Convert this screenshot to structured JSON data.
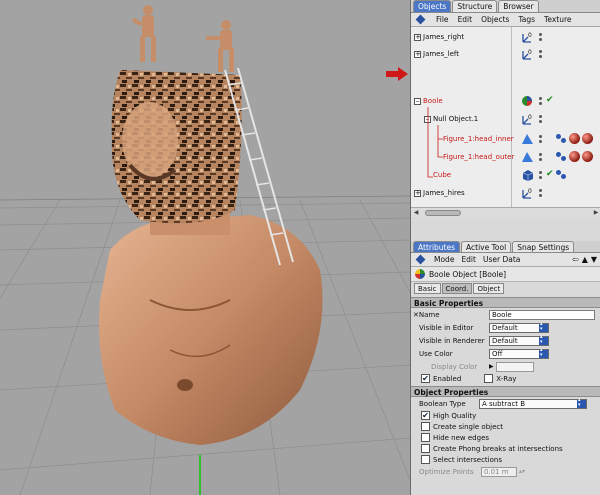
{
  "objects_panel": {
    "tabs": [
      "Objects",
      "Structure",
      "Browser"
    ],
    "menu": [
      "File",
      "Edit",
      "Objects",
      "Tags",
      "Texture"
    ],
    "rows": [
      {
        "name": "James_right"
      },
      {
        "name": "James_left"
      },
      {
        "name": "Boole"
      },
      {
        "name": "Null Object.1"
      },
      {
        "name": "Figure_1:head_inner"
      },
      {
        "name": "Figure_1:head_outer"
      },
      {
        "name": "Cube"
      },
      {
        "name": "James_hires"
      }
    ],
    "null_icon_digit": "0"
  },
  "attributes_panel": {
    "tabs": [
      "Attributes",
      "Active Tool",
      "Snap Settings"
    ],
    "menu": [
      "Mode",
      "Edit",
      "User Data"
    ],
    "nav_arrows": [
      "⇦",
      "▲",
      "▼"
    ],
    "object_title": "Boole Object [Boole]",
    "subtabs": [
      "Basic",
      "Coord.",
      "Object"
    ],
    "basic_section": {
      "title": "Basic Properties",
      "name_label": "Name",
      "name_prefix": "✕",
      "name_value": "Boole",
      "visible_editor_label": "Visible in Editor",
      "visible_editor_value": "Default",
      "visible_renderer_label": "Visible in Renderer",
      "visible_renderer_value": "Default",
      "use_color_label": "Use Color",
      "use_color_value": "Off",
      "display_color_label": "Display Color",
      "enabled_label": "Enabled",
      "xray_label": "X-Ray"
    },
    "object_section": {
      "title": "Object Properties",
      "boolean_type_label": "Boolean Type",
      "boolean_type_value": "A subtract B",
      "high_quality_label": "High Quality",
      "create_single_label": "Create single object",
      "hide_edges_label": "Hide new edges",
      "phong_breaks_label": "Create Phong breaks at intersections",
      "select_intersections_label": "Select intersections",
      "optimize_points_label": "Optimize Points",
      "optimize_points_value": "0.01 m"
    }
  },
  "colors": {
    "tab_active": "#4c76c6",
    "selected_label": "#c81919",
    "arrow_marker": "#d01818",
    "check": "#1f8a1f"
  }
}
